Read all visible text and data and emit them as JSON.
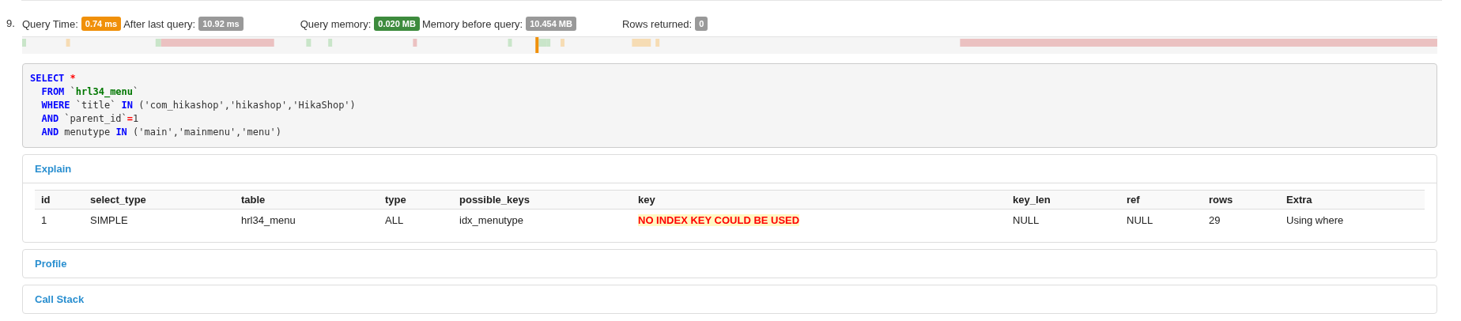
{
  "query": {
    "number": "9.",
    "stats": [
      {
        "label": "Query Time:",
        "badge": "0.74 ms",
        "color": "#f0900a"
      },
      {
        "label": "After last query:",
        "badge": "10.92 ms",
        "color": "#999999"
      },
      {
        "label": "Query memory:",
        "badge": "0.020 MB",
        "color": "#3d8b3d"
      },
      {
        "label": "Memory before query:",
        "badge": "10.454 MB",
        "color": "#999999"
      },
      {
        "label": "Rows returned:",
        "badge": "0",
        "color": "#999999"
      }
    ],
    "sql": [
      [
        {
          "kind": "keyword",
          "text": "SELECT "
        },
        {
          "kind": "operator",
          "text": "*"
        }
      ],
      [
        {
          "kind": "keyword",
          "text": "FROM "
        },
        {
          "kind": "plain",
          "text": "`"
        },
        {
          "kind": "table",
          "text": "hrl34_menu"
        },
        {
          "kind": "plain",
          "text": "`"
        }
      ],
      [
        {
          "kind": "keyword",
          "text": "WHERE "
        },
        {
          "kind": "plain",
          "text": "`title` "
        },
        {
          "kind": "keyword",
          "text": "IN "
        },
        {
          "kind": "plain",
          "text": "('com_hikashop','hikashop','HikaShop')"
        }
      ],
      [
        {
          "kind": "keyword",
          "text": "AND "
        },
        {
          "kind": "plain",
          "text": "`parent_id`"
        },
        {
          "kind": "operator",
          "text": "="
        },
        {
          "kind": "plain",
          "text": "1"
        }
      ],
      [
        {
          "kind": "keyword",
          "text": "AND "
        },
        {
          "kind": "plain",
          "text": "menutype "
        },
        {
          "kind": "keyword",
          "text": "IN "
        },
        {
          "kind": "plain",
          "text": "('main','mainmenu','menu')"
        }
      ]
    ],
    "panels": [
      {
        "title": "Explain",
        "expanded": true,
        "table": {
          "columns": [
            "id",
            "select_type",
            "table",
            "type",
            "possible_keys",
            "key",
            "key_len",
            "ref",
            "rows",
            "Extra"
          ],
          "rows": [
            [
              {
                "text": "1",
                "warning": false
              },
              {
                "text": "SIMPLE",
                "warning": false
              },
              {
                "text": "hrl34_menu",
                "warning": false
              },
              {
                "text": "ALL",
                "warning": false
              },
              {
                "text": "idx_menutype",
                "warning": false
              },
              {
                "text": "NO INDEX KEY COULD BE USED",
                "warning": true
              },
              {
                "text": "NULL",
                "warning": false
              },
              {
                "text": "NULL",
                "warning": false
              },
              {
                "text": "29",
                "warning": false
              },
              {
                "text": "Using where",
                "warning": false
              }
            ]
          ]
        }
      },
      {
        "title": "Profile",
        "expanded": false
      },
      {
        "title": "Call Stack",
        "expanded": false
      }
    ]
  }
}
